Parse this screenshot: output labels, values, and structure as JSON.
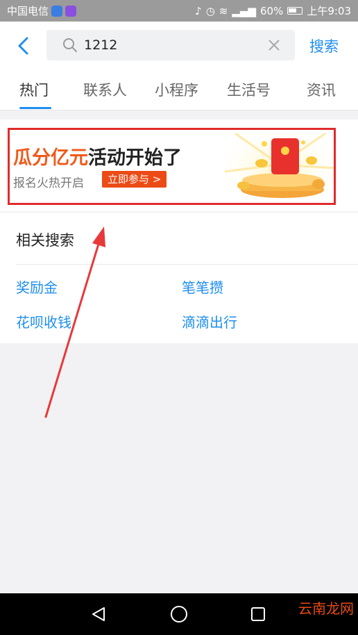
{
  "status": {
    "carrier": "中国电信",
    "battery": "60%",
    "time": "上午9:03"
  },
  "header": {
    "search_value": "1212",
    "search_button": "搜索"
  },
  "tabs": [
    {
      "label": "热门",
      "active": true
    },
    {
      "label": "联系人"
    },
    {
      "label": "小程序"
    },
    {
      "label": "生活号"
    },
    {
      "label": "资讯"
    }
  ],
  "banner": {
    "title_highlight": "瓜分亿元",
    "title_rest": "活动开始了",
    "subtitle": "报名火热开启",
    "cta": "立即参与 >"
  },
  "related": {
    "title": "相关搜索",
    "items": [
      "奖励金",
      "笔笔攒",
      "花呗收钱",
      "滴滴出行"
    ]
  },
  "watermark": "云南龙网",
  "colors": {
    "accent": "#1e8ef0",
    "highlight": "#f05a1a",
    "annotation": "#e02b2b"
  }
}
